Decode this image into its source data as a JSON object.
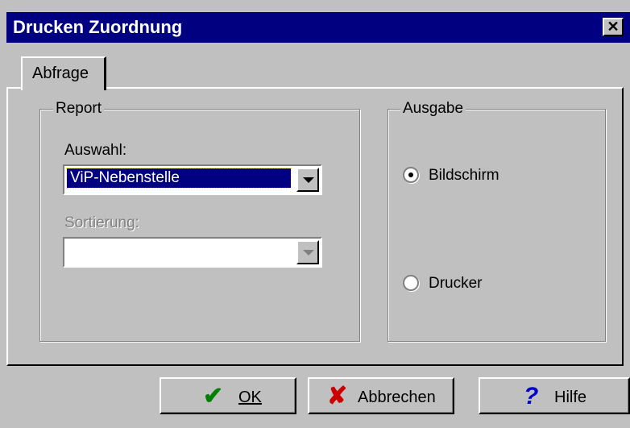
{
  "window": {
    "title": "Drucken Zuordnung",
    "close_glyph": "✕"
  },
  "tab": {
    "label": "Abfrage"
  },
  "report": {
    "title": "Report",
    "auswahl_label": "Auswahl:",
    "auswahl_value": "ViP-Nebenstelle",
    "sortierung_label": "Sortierung:",
    "sortierung_value": ""
  },
  "ausgabe": {
    "title": "Ausgabe",
    "options": [
      {
        "label": "Bildschirm",
        "selected": true
      },
      {
        "label": "Drucker",
        "selected": false
      }
    ]
  },
  "buttons": {
    "ok": {
      "label": "OK",
      "icon": "check-icon",
      "color": "#008000"
    },
    "cancel": {
      "label": "Abbrechen",
      "icon": "x-icon",
      "color": "#cc0000"
    },
    "help": {
      "label": "Hilfe",
      "icon": "question-icon",
      "color": "#0000cc"
    }
  }
}
